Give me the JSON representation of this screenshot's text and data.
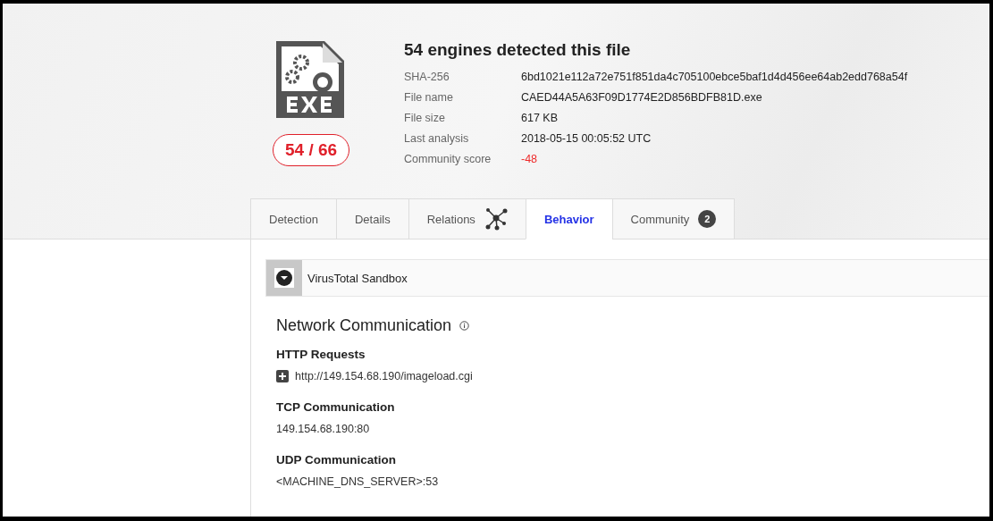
{
  "file_summary": {
    "title": "54 engines detected this file",
    "detection_ratio": "54 / 66",
    "fields": [
      {
        "label": "SHA-256",
        "value": "6bd1021e112a72e751f851da4c705100ebce5baf1d4d456ee64ab2edd768a54f",
        "kind": "text"
      },
      {
        "label": "File name",
        "value": "CAED44A5A63F09D1774E2D856BDFB81D.exe",
        "kind": "text"
      },
      {
        "label": "File size",
        "value": "617 KB",
        "kind": "text"
      },
      {
        "label": "Last analysis",
        "value": "2018-05-15 00:05:52 UTC",
        "kind": "text"
      },
      {
        "label": "Community score",
        "value": "-48",
        "kind": "negative"
      }
    ]
  },
  "tabs": [
    {
      "label": "Detection",
      "selected": false
    },
    {
      "label": "Details",
      "selected": false
    },
    {
      "label": "Relations",
      "selected": false,
      "kind": "graph"
    },
    {
      "label": "Behavior",
      "selected": true
    },
    {
      "label": "Community",
      "selected": false,
      "badge": "2"
    }
  ],
  "sandbox": {
    "title": "VirusTotal Sandbox",
    "expanded": true
  },
  "section": {
    "title": "Network Communication",
    "groups": [
      {
        "title": "HTTP Requests",
        "items": [
          {
            "text": "http://149.154.68.190/imageload.cgi",
            "expandable": true
          }
        ]
      },
      {
        "title": "TCP Communication",
        "items": [
          {
            "text": "149.154.68.190:80",
            "expandable": false
          }
        ]
      },
      {
        "title": "UDP Communication",
        "items": [
          {
            "text": "<MACHINE_DNS_SERVER>:53",
            "expandable": false
          }
        ]
      }
    ]
  }
}
